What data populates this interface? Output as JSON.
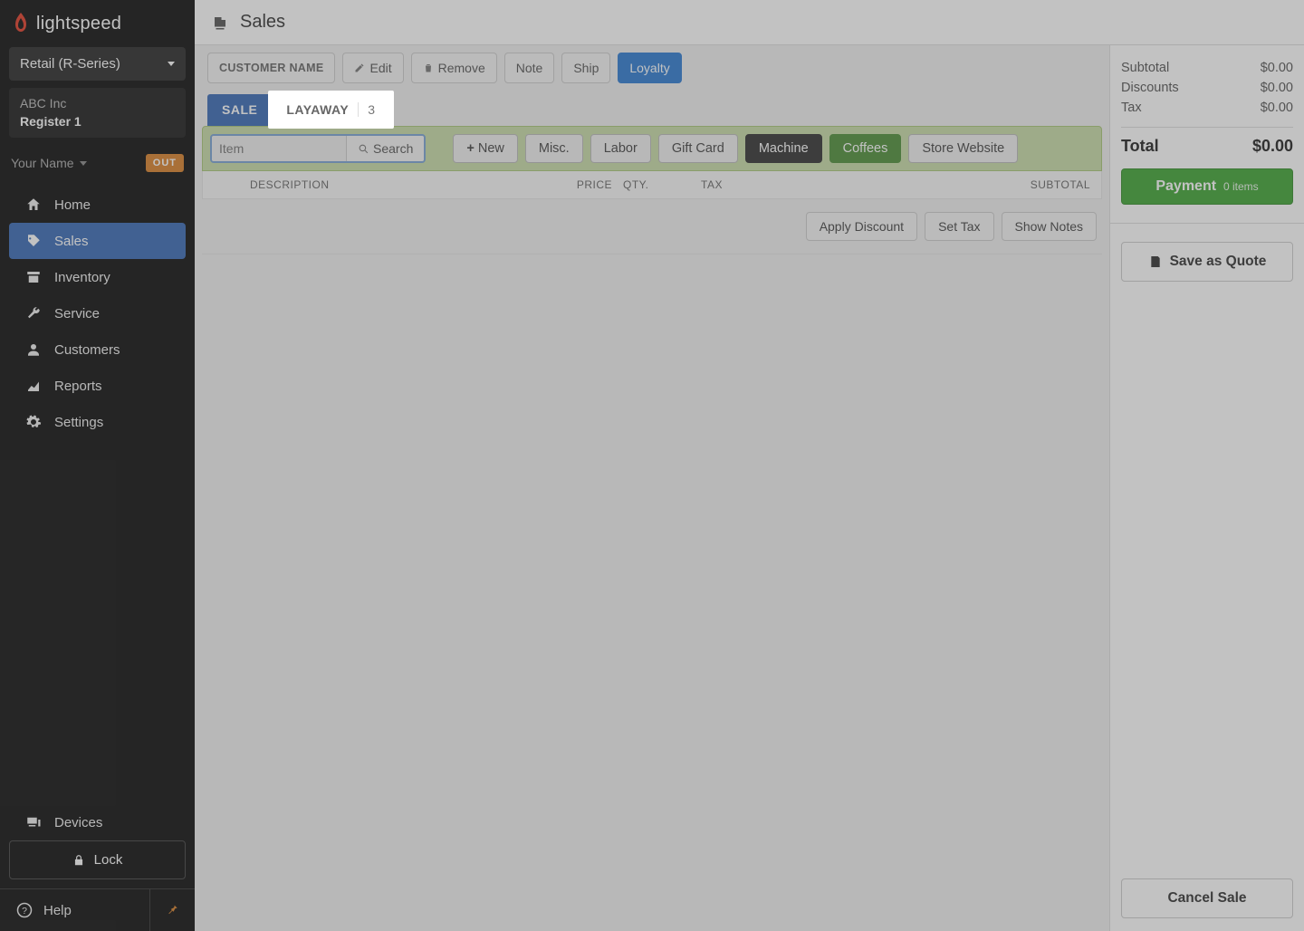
{
  "brand": "lightspeed",
  "storeSelector": {
    "label": "Retail (R-Series)"
  },
  "storeInfo": {
    "company": "ABC Inc",
    "register": "Register 1"
  },
  "user": {
    "name": "Your Name",
    "badge": "OUT"
  },
  "nav": {
    "home": "Home",
    "sales": "Sales",
    "inventory": "Inventory",
    "service": "Service",
    "customers": "Customers",
    "reports": "Reports",
    "settings": "Settings",
    "devices": "Devices",
    "lock": "Lock",
    "help": "Help"
  },
  "pageTitle": "Sales",
  "customerBar": {
    "customerName": "CUSTOMER NAME",
    "edit": "Edit",
    "remove": "Remove",
    "note": "Note",
    "ship": "Ship",
    "loyalty": "Loyalty"
  },
  "tabs": {
    "sale": "SALE",
    "layaway": "LAYAWAY",
    "layawayCount": "3"
  },
  "itemBar": {
    "placeholder": "Item",
    "search": "Search",
    "new": "New",
    "quick": {
      "misc": "Misc.",
      "labor": "Labor",
      "gift": "Gift Card",
      "machine": "Machine",
      "coffees": "Coffees",
      "website": "Store Website"
    }
  },
  "tableHeaders": {
    "description": "DESCRIPTION",
    "price": "PRICE",
    "qty": "QTY.",
    "tax": "TAX",
    "subtotal": "SUBTOTAL"
  },
  "rowActions": {
    "discount": "Apply Discount",
    "setTax": "Set Tax",
    "showNotes": "Show Notes"
  },
  "summary": {
    "subtotalLabel": "Subtotal",
    "subtotalValue": "$0.00",
    "discountsLabel": "Discounts",
    "discountsValue": "$0.00",
    "taxLabel": "Tax",
    "taxValue": "$0.00",
    "totalLabel": "Total",
    "totalValue": "$0.00",
    "paymentLabel": "Payment",
    "paymentItems": "0 items",
    "saveQuote": "Save as Quote",
    "cancelSale": "Cancel Sale"
  }
}
